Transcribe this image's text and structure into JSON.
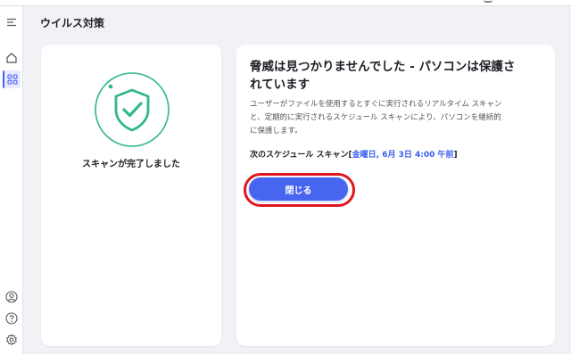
{
  "window": {
    "title": "ウイルス対策"
  },
  "sidebar": {
    "items": [
      {
        "icon": "hamburger-menu-icon"
      },
      {
        "icon": "home-icon"
      },
      {
        "icon": "apps-grid-icon",
        "active": true
      },
      {
        "icon": "account-icon"
      },
      {
        "icon": "help-icon"
      },
      {
        "icon": "gear-icon"
      }
    ]
  },
  "status_card": {
    "icon": "shield-check-icon",
    "status_text": "スキャンが完了しました",
    "accent_color": "#2fb88a"
  },
  "result_card": {
    "headline_line1": "脅威は見つかりませんでした - パソコンは保護さ",
    "headline_line2": "れています",
    "description_line1": "ユーザーがファイルを使用するとすぐに実行されるリアルタイム スキャン",
    "description_line2": "と、定期的に実行されるスケジュール スキャンにより、パソコンを継続的",
    "description_line3": "に保護します。",
    "schedule_label": "次のスケジュール スキャン",
    "schedule_value": "金曜日, 6月 3日 4:00 午前",
    "close_label": "閉じる",
    "button_color": "#4865f0",
    "highlight_color": "#e0161e"
  }
}
